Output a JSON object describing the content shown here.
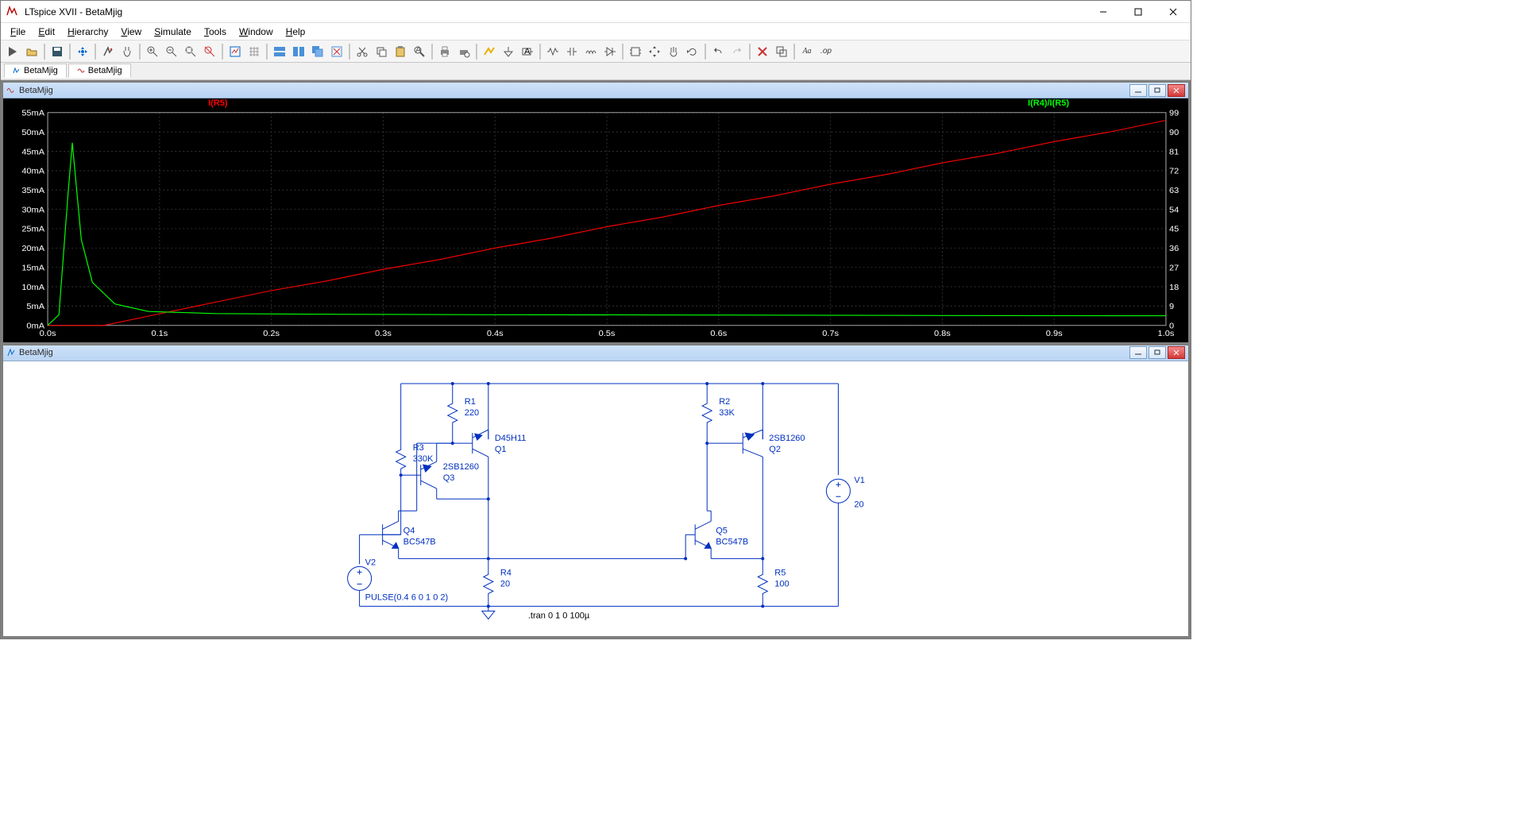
{
  "app": {
    "title": "LTspice XVII - BetaMjig",
    "icon_label": "app-icon"
  },
  "menu": {
    "items": [
      "File",
      "Edit",
      "Hierarchy",
      "View",
      "Simulate",
      "Tools",
      "Window",
      "Help"
    ]
  },
  "toolbar_icons": [
    "run",
    "open",
    "|",
    "save",
    "|",
    "control-panel",
    "|",
    "run-sim",
    "pan",
    "|",
    "zoom-in",
    "zoom-out",
    "zoom-fit",
    "zoom-rect",
    "|",
    "autorange",
    "toggle-grid",
    "|",
    "tile-horz",
    "tile-vert",
    "cascade",
    "close-all",
    "|",
    "cut",
    "copy",
    "paste",
    "find",
    "|",
    "print",
    "setup-print",
    "|",
    "draw-wire",
    "ground",
    "label-net",
    "|",
    "resistor",
    "capacitor",
    "inductor",
    "diode",
    "|",
    "component",
    "move",
    "drag",
    "rotate",
    "|",
    "undo",
    "redo",
    "|",
    "delete",
    "duplicate",
    "|",
    "text-Aa",
    "spice-directive"
  ],
  "doctabs": [
    {
      "icon": "schem",
      "label": "BetaMjig"
    },
    {
      "icon": "wave",
      "label": "BetaMjig"
    }
  ],
  "plot_pane": {
    "title": "BetaMjig",
    "legend_left": "I(R5)",
    "legend_right": "I(R4)/I(R5)"
  },
  "schem_pane": {
    "title": "BetaMjig"
  },
  "chart_data": {
    "type": "line",
    "title": "",
    "xlabel": "",
    "ylabel_left": "",
    "ylabel_right": "",
    "x_unit": "s",
    "x_ticks": [
      "0.0s",
      "0.1s",
      "0.2s",
      "0.3s",
      "0.4s",
      "0.5s",
      "0.6s",
      "0.7s",
      "0.8s",
      "0.9s",
      "1.0s"
    ],
    "y_left_unit": "mA",
    "y_left_ticks": [
      "0mA",
      "5mA",
      "10mA",
      "15mA",
      "20mA",
      "25mA",
      "30mA",
      "35mA",
      "40mA",
      "45mA",
      "50mA",
      "55mA"
    ],
    "y_right_ticks": [
      "0",
      "9",
      "18",
      "27",
      "36",
      "45",
      "54",
      "63",
      "72",
      "81",
      "90",
      "99"
    ],
    "xlim": [
      0.0,
      1.0
    ],
    "ylim_left": [
      0,
      55
    ],
    "ylim_right": [
      0,
      99
    ],
    "series": [
      {
        "name": "I(R5)",
        "color": "#ff0000",
        "axis": "left",
        "values": [
          [
            0.0,
            0.0
          ],
          [
            0.05,
            0.0
          ],
          [
            0.1,
            3.0
          ],
          [
            0.15,
            6.0
          ],
          [
            0.2,
            9.0
          ],
          [
            0.25,
            11.5
          ],
          [
            0.3,
            14.5
          ],
          [
            0.35,
            17.0
          ],
          [
            0.4,
            20.0
          ],
          [
            0.45,
            22.5
          ],
          [
            0.5,
            25.5
          ],
          [
            0.55,
            28.0
          ],
          [
            0.6,
            31.0
          ],
          [
            0.65,
            33.5
          ],
          [
            0.7,
            36.5
          ],
          [
            0.75,
            39.0
          ],
          [
            0.8,
            42.0
          ],
          [
            0.85,
            44.5
          ],
          [
            0.9,
            47.5
          ],
          [
            0.95,
            50.0
          ],
          [
            1.0,
            53.0
          ]
        ]
      },
      {
        "name": "I(R4)/I(R5)",
        "color": "#00ff00",
        "axis": "right",
        "values": [
          [
            0.0,
            0.0
          ],
          [
            0.01,
            5.0
          ],
          [
            0.018,
            60.0
          ],
          [
            0.022,
            85.0
          ],
          [
            0.03,
            40.0
          ],
          [
            0.04,
            20.0
          ],
          [
            0.06,
            10.0
          ],
          [
            0.09,
            6.5
          ],
          [
            0.15,
            5.5
          ],
          [
            0.25,
            5.2
          ],
          [
            0.4,
            5.0
          ],
          [
            0.6,
            4.8
          ],
          [
            0.8,
            4.6
          ],
          [
            1.0,
            4.5
          ]
        ]
      }
    ]
  },
  "schematic": {
    "directive": ".tran 0 1 0 100µ",
    "components": {
      "R1": {
        "name": "R1",
        "value": "220"
      },
      "R2": {
        "name": "R2",
        "value": "33K"
      },
      "R3": {
        "name": "R3",
        "value": "330K"
      },
      "R4": {
        "name": "R4",
        "value": "20"
      },
      "R5": {
        "name": "R5",
        "value": "100"
      },
      "Q1": {
        "name": "Q1",
        "model": "D45H11"
      },
      "Q2": {
        "name": "Q2",
        "model": "2SB1260"
      },
      "Q3": {
        "name": "Q3",
        "model": "2SB1260"
      },
      "Q4": {
        "name": "Q4",
        "model": "BC547B"
      },
      "Q5": {
        "name": "Q5",
        "model": "BC547B"
      },
      "V1": {
        "name": "V1",
        "value": "20"
      },
      "V2": {
        "name": "V2",
        "value": "PULSE(0.4 6 0 1 0 2)"
      }
    }
  }
}
